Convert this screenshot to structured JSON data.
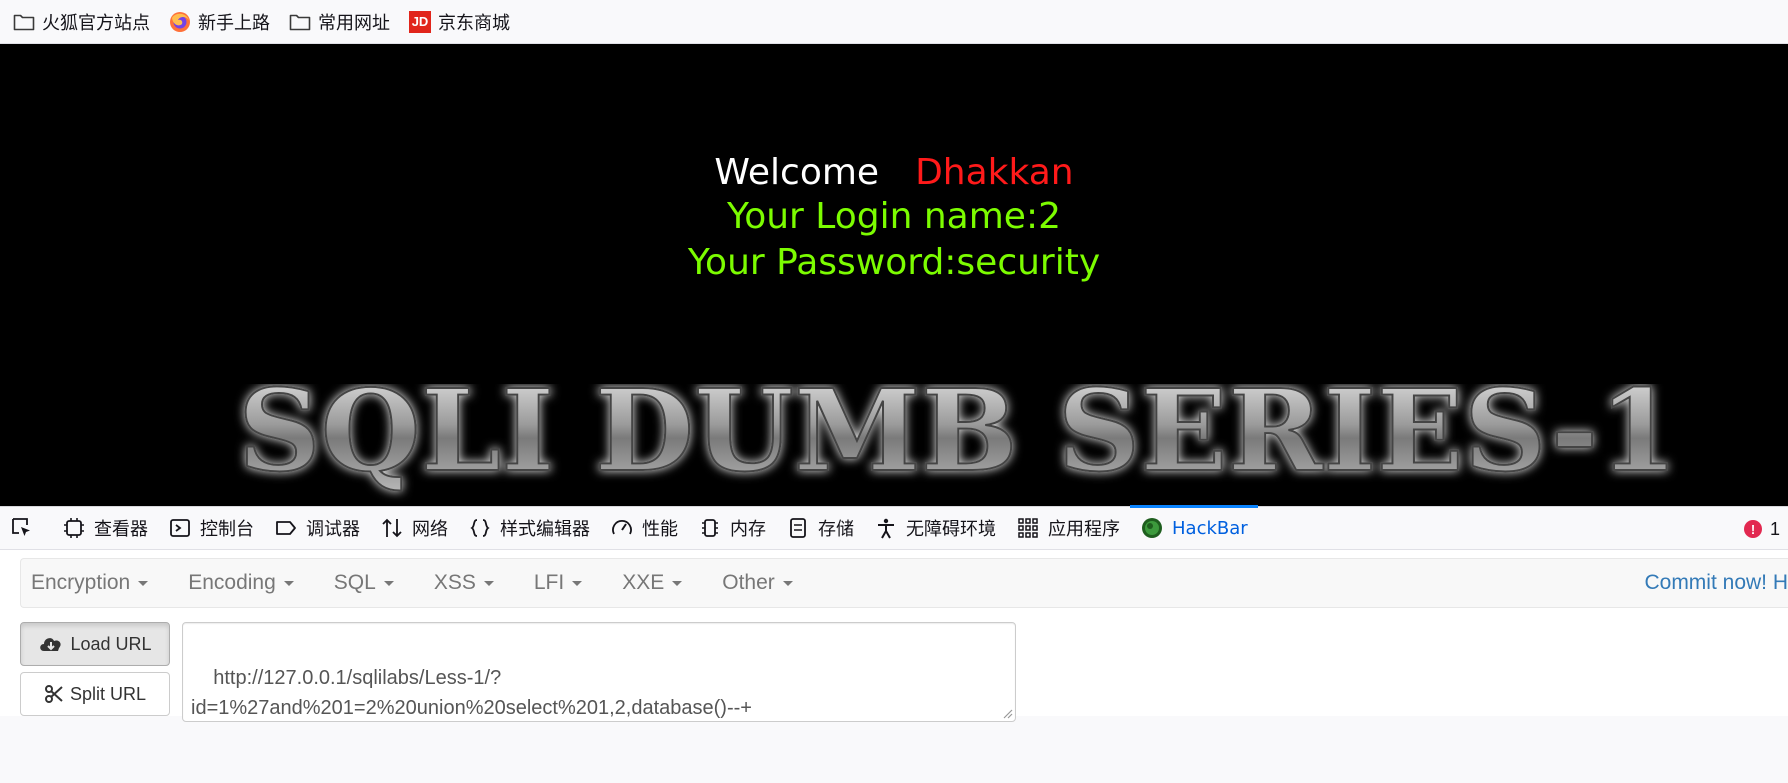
{
  "bookmarks": [
    {
      "label": "火狐官方站点",
      "icon": "folder-icon"
    },
    {
      "label": "新手上路",
      "icon": "firefox-icon"
    },
    {
      "label": "常用网址",
      "icon": "folder-icon"
    },
    {
      "label": "京东商城",
      "icon": "jd-icon",
      "icon_text": "JD"
    }
  ],
  "page": {
    "welcome": "Welcome",
    "welcome_name": "Dhakkan",
    "login_name": "Your Login name:2",
    "password": "Your Password:security",
    "banner_title": "SQLI DUMB SERIES-1"
  },
  "devtools": {
    "tabs": [
      {
        "label": "查看器",
        "icon": "inspector-icon"
      },
      {
        "label": "控制台",
        "icon": "console-icon"
      },
      {
        "label": "调试器",
        "icon": "debugger-icon"
      },
      {
        "label": "网络",
        "icon": "network-icon"
      },
      {
        "label": "样式编辑器",
        "icon": "style-editor-icon"
      },
      {
        "label": "性能",
        "icon": "performance-icon"
      },
      {
        "label": "内存",
        "icon": "memory-icon"
      },
      {
        "label": "存储",
        "icon": "storage-icon"
      },
      {
        "label": "无障碍环境",
        "icon": "accessibility-icon"
      },
      {
        "label": "应用程序",
        "icon": "application-icon"
      },
      {
        "label": "HackBar",
        "icon": "hackbar-icon",
        "active": true
      }
    ],
    "error_count": "1",
    "error_badge": "!"
  },
  "hackbar": {
    "menu": [
      "Encryption",
      "Encoding",
      "SQL",
      "XSS",
      "LFI",
      "XXE",
      "Other"
    ],
    "commit": "Commit now! H",
    "load_url": "Load URL",
    "split_url": "Split URL",
    "url_value": "http://127.0.0.1/sqlilabs/Less-1/?\nid=1%27and%201=2%20union%20select%201,2,database()--+"
  },
  "colors": {
    "welcome_name": "#ff1a1a",
    "login_text": "#7cfc00",
    "active_tab": "#0060df",
    "commit_link": "#337ab7"
  }
}
